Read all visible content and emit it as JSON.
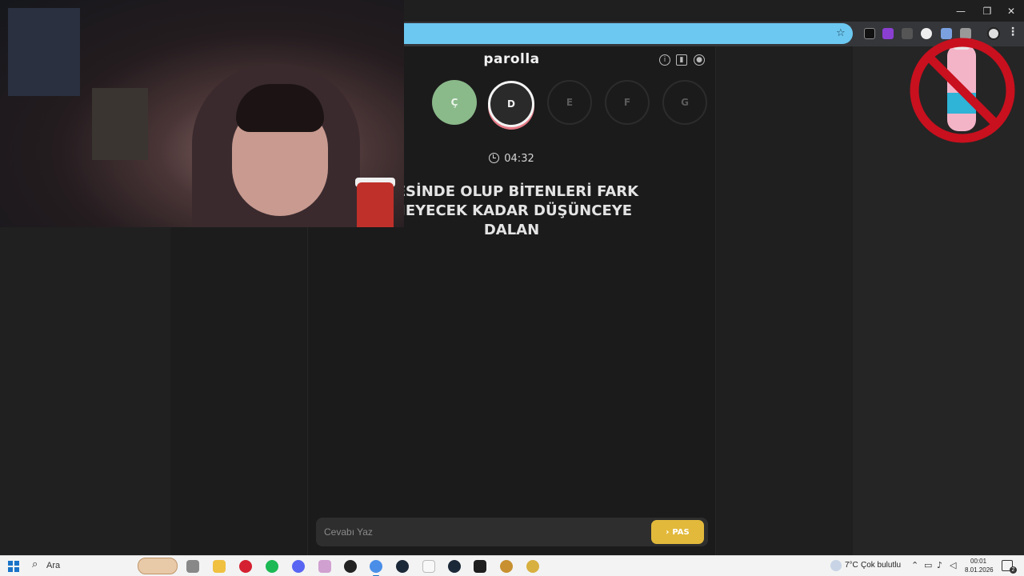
{
  "window": {
    "minimize": "—",
    "maximize": "❐",
    "close": "✕"
  },
  "browser": {
    "star_icon": "star-icon",
    "menu_icon": "⋮"
  },
  "game": {
    "title": "parolla",
    "letters": [
      {
        "label": "",
        "state": "done"
      },
      {
        "label": "Ç",
        "state": "done"
      },
      {
        "label": "D",
        "state": "active"
      },
      {
        "label": "E",
        "state": "pending"
      },
      {
        "label": "F",
        "state": "pending"
      },
      {
        "label": "G",
        "state": "pending"
      }
    ],
    "timer": "04:32",
    "question_line1": "RESİNDE OLUP BİTENLERİ FARK",
    "question_line2": "MEYECEK KADAR DÜŞÜNCEYE",
    "question_line3": "DALAN",
    "answer_placeholder": "Cevabı Yaz",
    "pass_label": "PAS",
    "pass_icon": "›"
  },
  "taskbar": {
    "search_label": "Ara",
    "weather_temp": "7°C",
    "weather_desc": "Çok bulutlu",
    "clock_time": "00:01",
    "clock_date": "8.01.2026",
    "notification_count": "2"
  },
  "colors": {
    "done": "#8ab98a",
    "active_ring": "#f3f3f3",
    "active_underline": "#e57a86",
    "pass_button": "#e2b93b",
    "address_bar": "#6cc8f0"
  }
}
